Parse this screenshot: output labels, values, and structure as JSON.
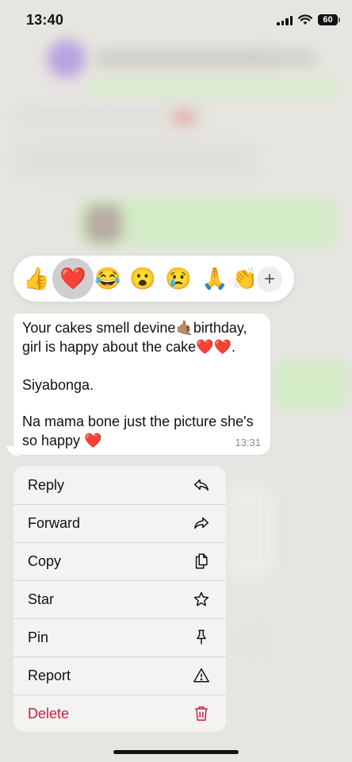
{
  "status_bar": {
    "time": "13:40",
    "battery": "60"
  },
  "reactions": [
    "👍",
    "❤️",
    "😂",
    "😮",
    "😢",
    "🙏",
    "👏"
  ],
  "reaction_more": "+",
  "message": {
    "lines": [
      "Your cakes smell devine🤙🏽birthday,",
      "girl is happy about the cake❤️❤️.",
      "",
      "Siyabonga.",
      "",
      "Na mama bone just the picture she's",
      "so happy ❤️"
    ],
    "time": "13:31"
  },
  "menu": {
    "items": [
      {
        "label": "Reply",
        "icon": "reply-icon"
      },
      {
        "label": "Forward",
        "icon": "forward-icon"
      },
      {
        "label": "Copy",
        "icon": "copy-icon"
      },
      {
        "label": "Star",
        "icon": "star-icon"
      },
      {
        "label": "Pin",
        "icon": "pin-icon"
      },
      {
        "label": "Report",
        "icon": "report-icon"
      },
      {
        "label": "Delete",
        "icon": "trash-icon"
      }
    ]
  },
  "colors": {
    "danger": "#c5203e",
    "accent_green": "#d9f5c8",
    "background": "#e7e5e1"
  }
}
